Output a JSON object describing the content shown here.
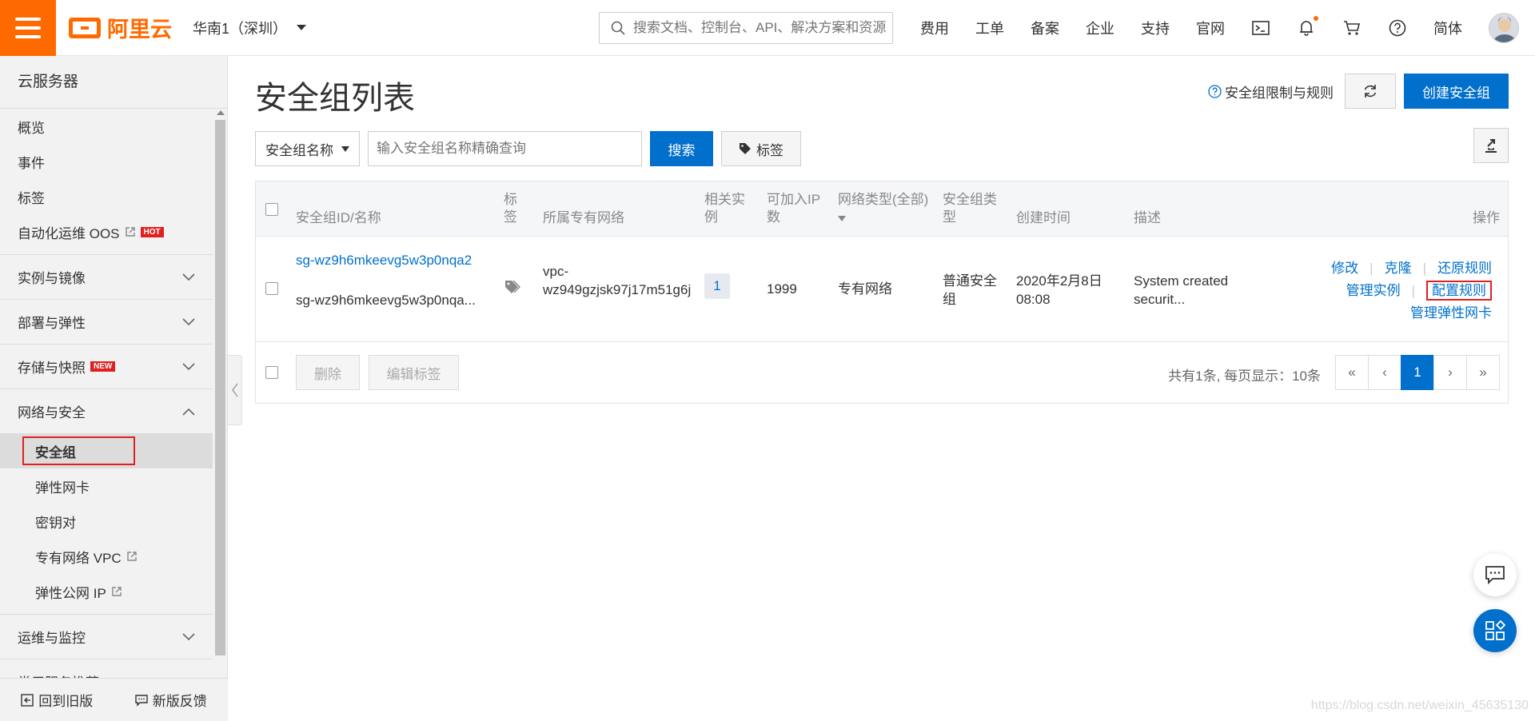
{
  "header": {
    "logo_text": "阿里云",
    "region": "华南1（深圳）",
    "search_placeholder": "搜索文档、控制台、API、解决方案和资源",
    "nav": [
      "费用",
      "工单",
      "备案",
      "企业",
      "支持",
      "官网"
    ],
    "lang": "简体",
    "accent_color": "#ff6a00"
  },
  "sidebar": {
    "title": "云服务器",
    "top_items": [
      "概览",
      "事件",
      "标签"
    ],
    "oos_label": "自动化运维 OOS",
    "hot_badge": "HOT",
    "new_badge": "NEW",
    "groups": {
      "instances": "实例与镜像",
      "deploy": "部署与弹性",
      "storage": "存储与快照",
      "network": "网络与安全",
      "ops": "运维与监控",
      "recommend": "常用服务推荐"
    },
    "network_items": {
      "security_group": "安全组",
      "eni": "弹性网卡",
      "keypair": "密钥对",
      "vpc": "专有网络 VPC",
      "eip": "弹性公网 IP"
    },
    "bottom": {
      "old_version": "回到旧版",
      "feedback": "新版反馈"
    }
  },
  "main": {
    "title": "安全组列表",
    "help_link": "安全组限制与规则",
    "create_button": "创建安全组",
    "filter": {
      "select_value": "安全组名称",
      "input_placeholder": "输入安全组名称精确查询",
      "search_button": "搜索",
      "tag_button": "标签"
    },
    "table": {
      "headers": {
        "id": "安全组ID/名称",
        "tag": "标签",
        "vpc": "所属专有网络",
        "instances": "相关实例",
        "ip_count": "可加入IP数",
        "net_type": "网络类型(全部)",
        "sg_type": "安全组类型",
        "created": "创建时间",
        "desc": "描述",
        "ops": "操作"
      },
      "row": {
        "id": "sg-wz9h6mkeevg5w3p0nqa2",
        "name": "sg-wz9h6mkeevg5w3p0nqa...",
        "vpc_line1": "vpc-",
        "vpc_line2": "wz949gzjsk97j17m51g6j",
        "instance_count": "1",
        "ip_count": "1999",
        "net_type": "专有网络",
        "sg_type": "普通安全组",
        "created_date": "2020年2月8日",
        "created_time": "08:08",
        "desc_line1": "System created",
        "desc_line2": "securit...",
        "ops": {
          "modify": "修改",
          "clone": "克隆",
          "restore": "还原规则",
          "manage_instances": "管理实例",
          "configure_rules": "配置规则",
          "manage_eni": "管理弹性网卡"
        }
      }
    },
    "footer": {
      "delete_button": "删除",
      "edit_tags_button": "编辑标签",
      "page_info": "共有1条, 每页显示：10条",
      "pager": [
        "«",
        "‹",
        "1",
        "›",
        "»"
      ]
    }
  },
  "watermark": "https://blog.csdn.net/weixin_45635130"
}
